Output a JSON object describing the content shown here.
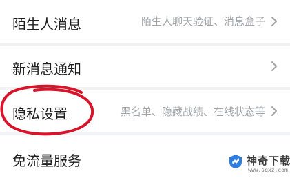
{
  "settings": {
    "items": [
      {
        "title": "陌生人消息",
        "subtitle": "陌生人聊天验证、消息盒子"
      },
      {
        "title": "新消息通知",
        "subtitle": ""
      },
      {
        "title": "隐私设置",
        "subtitle": "黑名单、隐藏战绩、在线状态等"
      },
      {
        "title": "免流量服务",
        "subtitle": ""
      }
    ]
  },
  "annotation": {
    "color": "#d8142b"
  },
  "watermark": {
    "name": "神奇下载",
    "url": "www.sqxz.com"
  },
  "colors": {
    "title": "#1e1e1e",
    "subtitle": "#a2a4a8",
    "chevron": "#a2a4a8",
    "divider": "#f2f3f5"
  }
}
